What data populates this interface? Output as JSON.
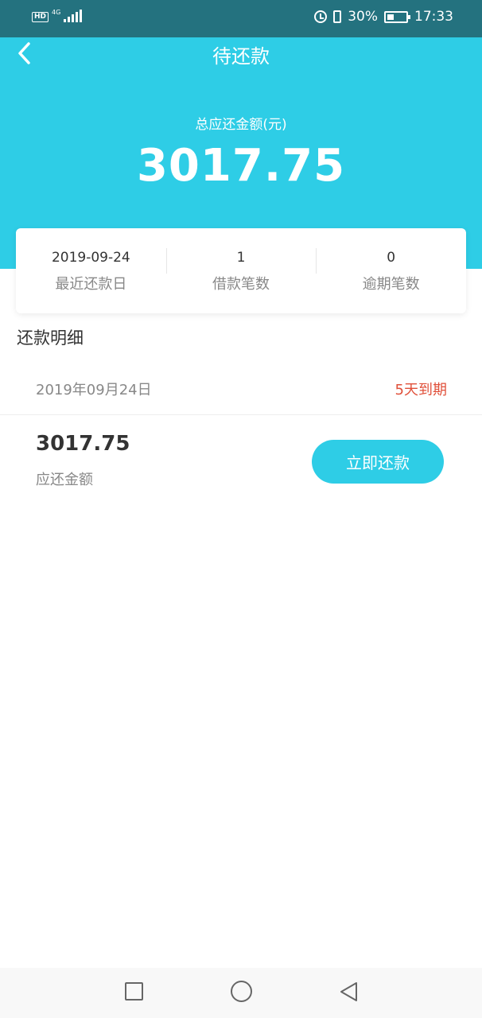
{
  "status_bar": {
    "hd_badge": "HD",
    "network": "4G",
    "battery_percent": "30%",
    "time": "17:33"
  },
  "header": {
    "title": "待还款",
    "total_label": "总应还金额(元)",
    "total_amount": "3017.75"
  },
  "stats": [
    {
      "value": "2019-09-24",
      "label": "最近还款日"
    },
    {
      "value": "1",
      "label": "借款笔数"
    },
    {
      "value": "0",
      "label": "逾期笔数"
    }
  ],
  "detail": {
    "section_title": "还款明细",
    "date": "2019年09月24日",
    "due_status": "5天到期",
    "amount": "3017.75",
    "amount_label": "应还金额",
    "pay_button_label": "立即还款"
  },
  "colors": {
    "primary": "#2ecde6",
    "status_bar": "#24727f",
    "due_warning": "#e0503a",
    "text_dark": "#333333",
    "text_muted": "#888888"
  },
  "icons": {
    "back": "back-chevron-icon",
    "nav_recent": "square-icon",
    "nav_home": "circle-icon",
    "nav_back": "triangle-back-icon"
  }
}
